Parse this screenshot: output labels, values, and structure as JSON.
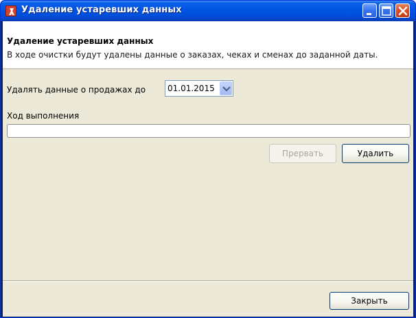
{
  "window": {
    "title": "Удаление устаревших данных",
    "title_color": "#ffffff",
    "titlebar_color": "#0054e3",
    "icon": "app-icon"
  },
  "header": {
    "title": "Удаление устаревших данных",
    "description": "В ходе очистки будут удалены данные о заказах, чеках и сменах до заданной даты."
  },
  "form": {
    "date_label": "Удалять данные о продажах до",
    "date_value": "01.01.2015",
    "progress_label": "Ход выполнения",
    "progress_fraction": 0
  },
  "buttons": {
    "cancel": "Прервать",
    "delete": "Удалить",
    "close": "Закрыть"
  },
  "colors": {
    "window_bg": "#ece9d8",
    "header_bg": "#ffffff",
    "disabled_text": "#aca899"
  }
}
